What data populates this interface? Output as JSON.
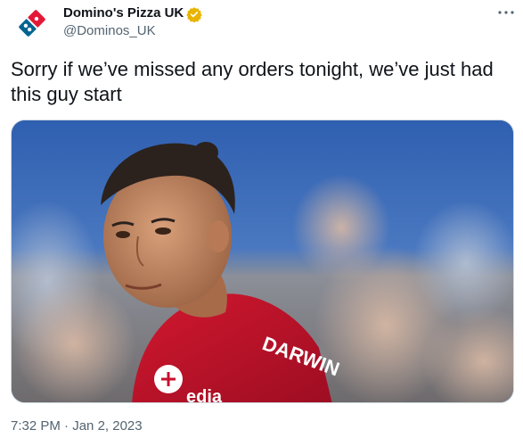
{
  "author": {
    "display_name": "Domino's Pizza UK",
    "handle": "@Dominos_UK",
    "avatar_icon": "dominos-logo-icon",
    "verified_icon": "verified-badge-icon",
    "verified_color": "#e8b400"
  },
  "menu": {
    "more_icon": "more-options-icon"
  },
  "tweet": {
    "text": "Sorry if we’ve missed any orders tonight, we’ve just had this guy start"
  },
  "media": {
    "jersey_text": "DARWIN",
    "sponsor_text": "edia"
  },
  "meta": {
    "time": "7:32 PM",
    "separator": " · ",
    "date": "Jan 2, 2023"
  },
  "colors": {
    "text_primary": "#0f1419",
    "text_secondary": "#536471",
    "dominos_blue": "#006491",
    "dominos_red": "#e31837",
    "jersey_red": "#c8102e"
  }
}
